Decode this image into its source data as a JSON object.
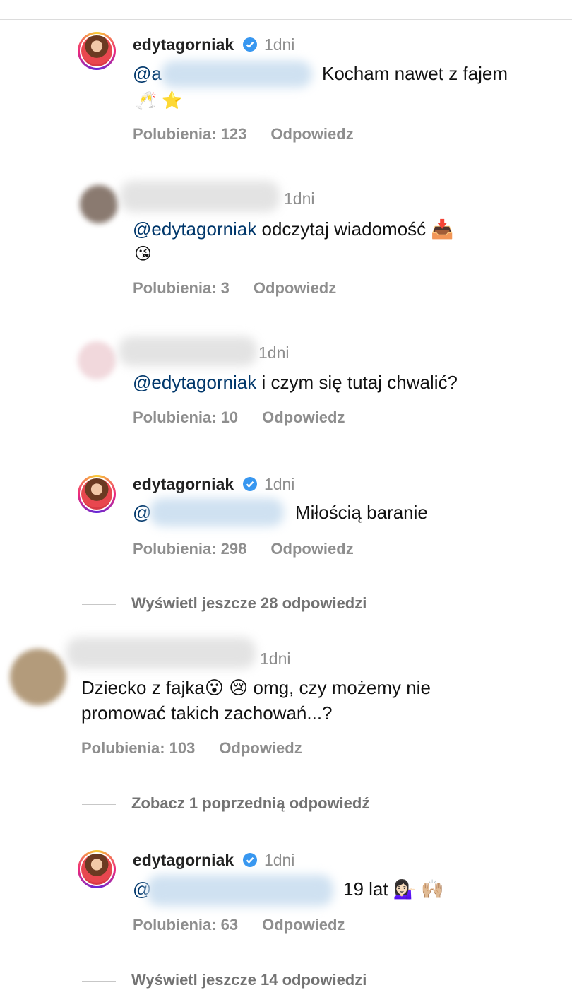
{
  "comments": [
    {
      "username": "edytagorniak",
      "time": "1dni",
      "mention_prefix": "@a",
      "text": "Kocham nawet z fajem",
      "emoji": "🥂 ⭐",
      "likes": "Polubienia: 123",
      "reply": "Odpowiedz"
    },
    {
      "time": "1dni",
      "mention": "@edytagorniak",
      "text": "odczytaj wiadomość 📥",
      "emoji": "😘",
      "likes": "Polubienia: 3",
      "reply": "Odpowiedz"
    },
    {
      "time": "1dni",
      "mention": "@edytagorniak",
      "text": "i czym się tutaj chwalić?",
      "likes": "Polubienia: 10",
      "reply": "Odpowiedz"
    },
    {
      "username": "edytagorniak",
      "time": "1dni",
      "mention_prefix": "@",
      "text": "Miłością baranie",
      "likes": "Polubienia: 298",
      "reply": "Odpowiedz"
    }
  ],
  "more_replies_1": "Wyświetl jeszcze 28 odpowiedzi",
  "parent": {
    "time": "1dni",
    "text_line1": "Dziecko z fajka😮 😢 omg, czy możemy nie",
    "text_line2": "promować takich zachowań...?",
    "likes": "Polubienia: 103",
    "reply": "Odpowiedz"
  },
  "previous_reply": "Zobacz 1 poprzednią odpowiedź",
  "last_reply": {
    "username": "edytagorniak",
    "time": "1dni",
    "mention_prefix": "@",
    "text": "19 lat 💁🏻‍♀️ 🙌🏼",
    "likes": "Polubienia: 63",
    "reply": "Odpowiedz"
  },
  "more_replies_2": "Wyświetl jeszcze 14 odpowiedzi",
  "colors": {
    "mention": "#00376b",
    "meta": "#8e8e8e",
    "verified": "#3897f0"
  }
}
